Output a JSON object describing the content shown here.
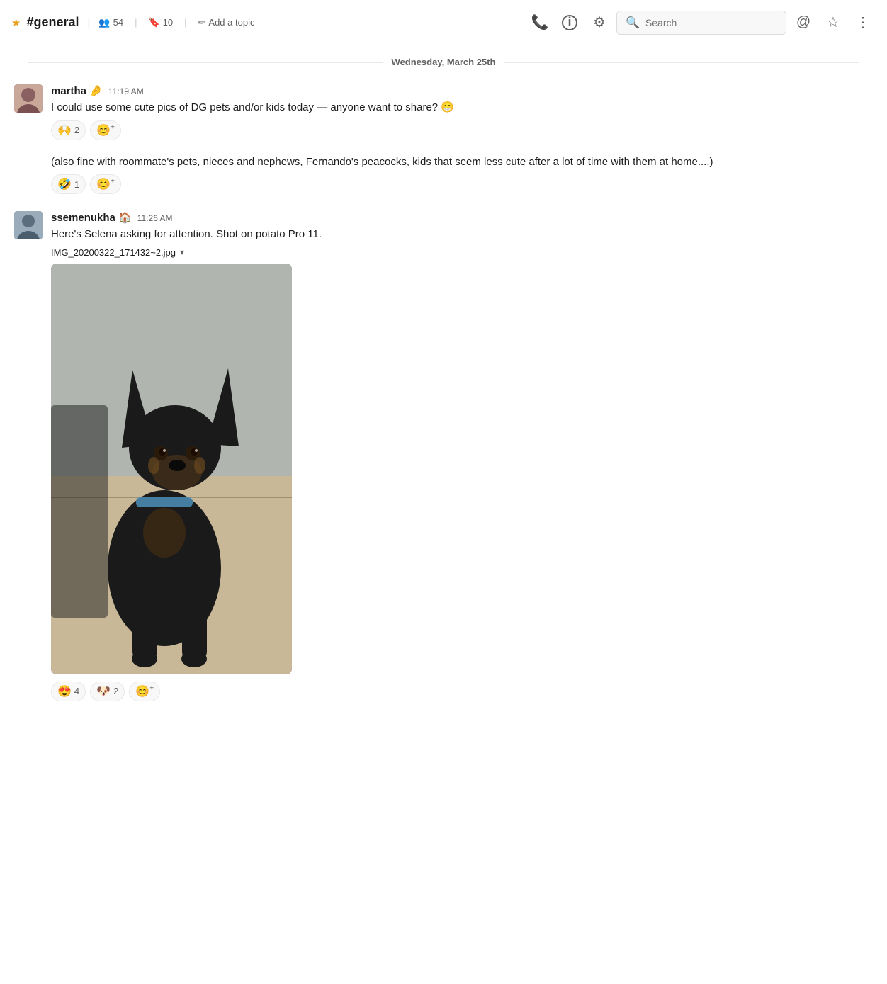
{
  "header": {
    "channel_name": "#general",
    "members_count": "54",
    "pinned_count": "10",
    "add_topic_label": "Add a topic",
    "search_placeholder": "Search",
    "icons": {
      "phone": "☎",
      "info": "ⓘ",
      "settings": "⚙",
      "search": "🔍",
      "at": "@",
      "star": "☆",
      "more": "⋮"
    }
  },
  "date_separator": "Wednesday, March 25th",
  "messages": [
    {
      "id": "msg1",
      "username": "martha",
      "username_emoji": "🤌",
      "timestamp": "11:19 AM",
      "text": "I could use some cute pics of DG pets and/or kids today — anyone want to share? 😁",
      "reactions": [
        {
          "emoji": "🙌",
          "count": "2"
        },
        {
          "add": true
        }
      ],
      "continuation": {
        "text": "(also fine with roommate's pets, nieces and nephews, Fernando's peacocks, kids that seem less cute after a lot of time with them at home....)",
        "reactions": [
          {
            "emoji": "🤣",
            "count": "1"
          },
          {
            "add": true
          }
        ]
      }
    },
    {
      "id": "msg2",
      "username": "ssemenukha",
      "username_emoji": "🏠",
      "timestamp": "11:26 AM",
      "text": "Here's Selena asking for attention. Shot on potato Pro 11.",
      "attachment_filename": "IMG_20200322_171432~2.jpg",
      "reactions": [
        {
          "emoji": "😍",
          "count": "4"
        },
        {
          "emoji": "🐶",
          "count": "2"
        },
        {
          "add": true
        }
      ]
    }
  ]
}
